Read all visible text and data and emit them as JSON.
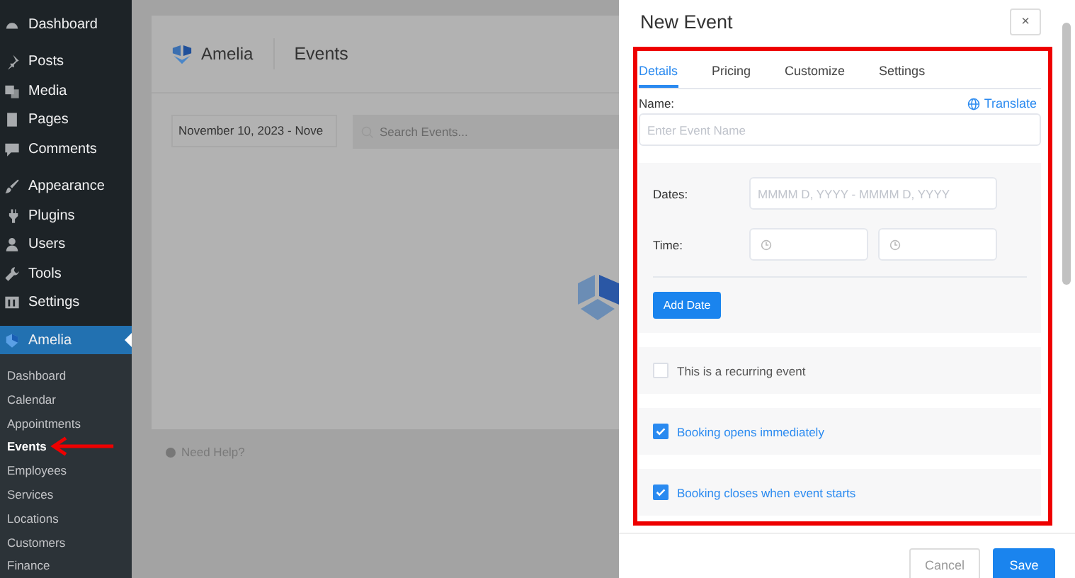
{
  "sidebar": {
    "items": [
      {
        "label": "Dashboard",
        "selected": false
      },
      {
        "label": "Posts",
        "selected": false
      },
      {
        "label": "Media",
        "selected": false
      },
      {
        "label": "Pages",
        "selected": false
      },
      {
        "label": "Comments",
        "selected": false
      },
      {
        "label": "Appearance",
        "selected": false
      },
      {
        "label": "Plugins",
        "selected": false
      },
      {
        "label": "Users",
        "selected": false
      },
      {
        "label": "Tools",
        "selected": false
      },
      {
        "label": "Settings",
        "selected": false
      },
      {
        "label": "Amelia",
        "selected": true
      }
    ],
    "submenu": [
      {
        "label": "Dashboard",
        "selected": false
      },
      {
        "label": "Calendar",
        "selected": false
      },
      {
        "label": "Appointments",
        "selected": false
      },
      {
        "label": "Events",
        "selected": true
      },
      {
        "label": "Employees",
        "selected": false
      },
      {
        "label": "Services",
        "selected": false
      },
      {
        "label": "Locations",
        "selected": false
      },
      {
        "label": "Customers",
        "selected": false
      },
      {
        "label": "Finance",
        "selected": false
      }
    ]
  },
  "page": {
    "brand": "Amelia",
    "title": "Events",
    "date_range": "November 10, 2023 - Nove",
    "search": {
      "placeholder": "Search Events..."
    },
    "help": "Need Help?"
  },
  "dialog": {
    "title": "New Event",
    "close": "×",
    "tabs": [
      {
        "label": "Details",
        "selected": true
      },
      {
        "label": "Pricing",
        "selected": false
      },
      {
        "label": "Customize",
        "selected": false
      },
      {
        "label": "Settings",
        "selected": false
      }
    ],
    "name_label": "Name:",
    "translate": "Translate",
    "name_field": {
      "placeholder": "Enter Event Name"
    },
    "dates_label": "Dates:",
    "dates_field": {
      "placeholder": "MMMM D, YYYY - MMMM D, YYYY"
    },
    "time_label": "Time:",
    "add_date": "Add Date",
    "options": [
      {
        "label": "This is a recurring event",
        "checked": false
      },
      {
        "label": "Booking opens immediately",
        "checked": true
      },
      {
        "label": "Booking closes when event starts",
        "checked": true
      }
    ],
    "buttons": [
      {
        "label": "Cancel",
        "kind": "secondary"
      },
      {
        "label": "Save",
        "kind": "primary"
      }
    ]
  }
}
